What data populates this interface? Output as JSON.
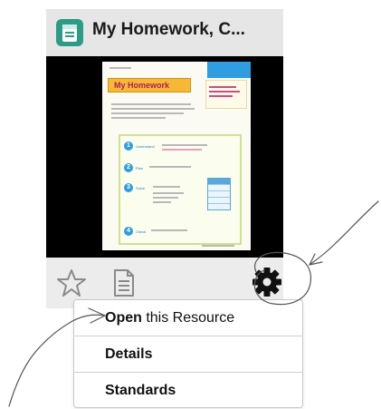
{
  "card": {
    "title": "My Homework, C...",
    "preview": {
      "page_heading": "My Homework",
      "steps": [
        {
          "num": "1",
          "label": "Understand"
        },
        {
          "num": "2",
          "label": "Plan"
        },
        {
          "num": "3",
          "label": "Solve"
        },
        {
          "num": "4",
          "label": "Check"
        }
      ]
    }
  },
  "menu": {
    "items": [
      {
        "bold": "Open",
        "rest": " this Resource"
      },
      {
        "bold": "Details",
        "rest": ""
      },
      {
        "bold": "Standards",
        "rest": ""
      }
    ]
  },
  "icons": {
    "resource": "document-icon",
    "favorite": "star-icon",
    "info": "page-icon",
    "settings": "gear-icon"
  },
  "colors": {
    "resource_icon": "#2d9c86",
    "ribbon": "#f6b936",
    "ribbon_text": "#b31b5e",
    "step_blue": "#2f9de0"
  }
}
